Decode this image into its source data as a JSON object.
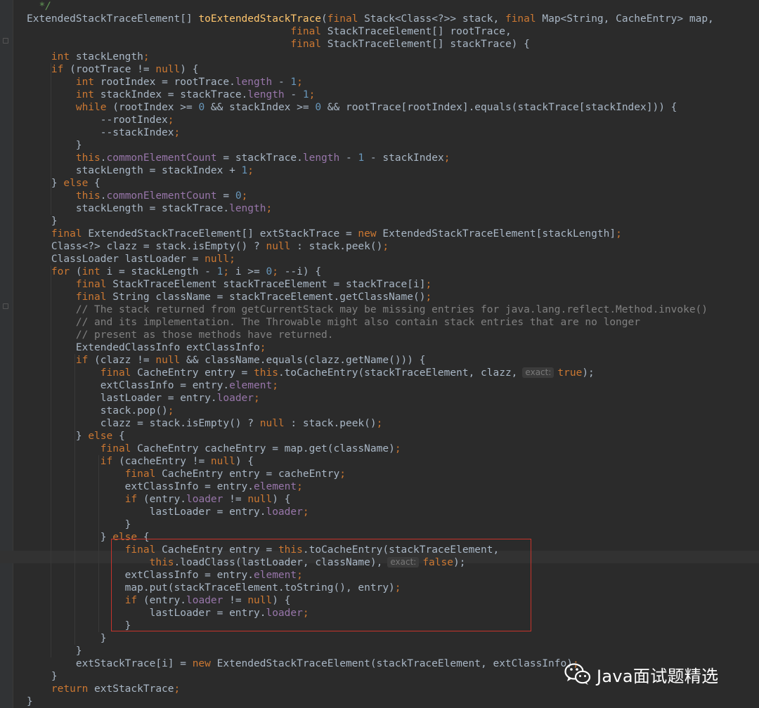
{
  "watermark": {
    "text": "Java面试题精选",
    "icon": "wechat-icon"
  },
  "hints": {
    "exact": "exact:"
  },
  "colors": {
    "background": "#2b2b2b",
    "keyword": "#cc7832",
    "number": "#6897bb",
    "method": "#ffc66d",
    "field": "#9876aa",
    "comment": "#808080",
    "highlight_box": "#c8342c"
  },
  "lines": [
    [
      {
        "t": "  */",
        "c": "doc"
      }
    ],
    [
      {
        "t": "ExtendedStackTraceElement[] "
      },
      {
        "t": "toExtendedStackTrace",
        "c": "fn"
      },
      {
        "t": "("
      },
      {
        "t": "final ",
        "c": "kw"
      },
      {
        "t": "Stack<Class<?>> stack, "
      },
      {
        "t": "final ",
        "c": "kw"
      },
      {
        "t": "Map<String, CacheEntry> map,"
      }
    ],
    [
      {
        "t": "                                           "
      },
      {
        "t": "final ",
        "c": "kw"
      },
      {
        "t": "StackTraceElement[] rootTrace,"
      }
    ],
    [
      {
        "t": "                                           "
      },
      {
        "t": "final ",
        "c": "kw"
      },
      {
        "t": "StackTraceElement[] stackTrace) {"
      }
    ],
    [
      {
        "t": "    "
      },
      {
        "t": "int ",
        "c": "kw"
      },
      {
        "t": "stackLength"
      },
      {
        "t": ";",
        "c": "kw"
      }
    ],
    [
      {
        "t": "    "
      },
      {
        "t": "if ",
        "c": "kw"
      },
      {
        "t": "(rootTrace != "
      },
      {
        "t": "null",
        "c": "kw"
      },
      {
        "t": ") {"
      }
    ],
    [
      {
        "t": "        "
      },
      {
        "t": "int ",
        "c": "kw"
      },
      {
        "t": "rootIndex = rootTrace."
      },
      {
        "t": "length",
        "c": "field"
      },
      {
        "t": " - "
      },
      {
        "t": "1",
        "c": "num"
      },
      {
        "t": ";",
        "c": "kw"
      }
    ],
    [
      {
        "t": "        "
      },
      {
        "t": "int ",
        "c": "kw"
      },
      {
        "t": "stackIndex = stackTrace."
      },
      {
        "t": "length",
        "c": "field"
      },
      {
        "t": " - "
      },
      {
        "t": "1",
        "c": "num"
      },
      {
        "t": ";",
        "c": "kw"
      }
    ],
    [
      {
        "t": "        "
      },
      {
        "t": "while ",
        "c": "kw"
      },
      {
        "t": "(rootIndex >= "
      },
      {
        "t": "0",
        "c": "num"
      },
      {
        "t": " && stackIndex >= "
      },
      {
        "t": "0",
        "c": "num"
      },
      {
        "t": " && rootTrace[rootIndex].equals(stackTrace[stackIndex])) {"
      }
    ],
    [
      {
        "t": "            --rootIndex"
      },
      {
        "t": ";",
        "c": "kw"
      }
    ],
    [
      {
        "t": "            --stackIndex"
      },
      {
        "t": ";",
        "c": "kw"
      }
    ],
    [
      {
        "t": "        }"
      }
    ],
    [
      {
        "t": "        "
      },
      {
        "t": "this",
        "c": "kw"
      },
      {
        "t": "."
      },
      {
        "t": "commonElementCount",
        "c": "field"
      },
      {
        "t": " = stackTrace."
      },
      {
        "t": "length",
        "c": "field"
      },
      {
        "t": " - "
      },
      {
        "t": "1",
        "c": "num"
      },
      {
        "t": " - stackIndex"
      },
      {
        "t": ";",
        "c": "kw"
      }
    ],
    [
      {
        "t": "        stackLength = stackIndex + "
      },
      {
        "t": "1",
        "c": "num"
      },
      {
        "t": ";",
        "c": "kw"
      }
    ],
    [
      {
        "t": "    } "
      },
      {
        "t": "else ",
        "c": "kw"
      },
      {
        "t": "{"
      }
    ],
    [
      {
        "t": "        "
      },
      {
        "t": "this",
        "c": "kw"
      },
      {
        "t": "."
      },
      {
        "t": "commonElementCount",
        "c": "field"
      },
      {
        "t": " = "
      },
      {
        "t": "0",
        "c": "num"
      },
      {
        "t": ";",
        "c": "kw"
      }
    ],
    [
      {
        "t": "        stackLength = stackTrace."
      },
      {
        "t": "length",
        "c": "field"
      },
      {
        "t": ";",
        "c": "kw"
      }
    ],
    [
      {
        "t": "    }"
      }
    ],
    [
      {
        "t": "    "
      },
      {
        "t": "final ",
        "c": "kw"
      },
      {
        "t": "ExtendedStackTraceElement[] extStackTrace = "
      },
      {
        "t": "new ",
        "c": "kw"
      },
      {
        "t": "ExtendedStackTraceElement[stackLength]"
      },
      {
        "t": ";",
        "c": "kw"
      }
    ],
    [
      {
        "t": "    Class<?> clazz = stack.isEmpty() ? "
      },
      {
        "t": "null ",
        "c": "kw"
      },
      {
        "t": ": stack.peek()"
      },
      {
        "t": ";",
        "c": "kw"
      }
    ],
    [
      {
        "t": "    ClassLoader lastLoader = "
      },
      {
        "t": "null",
        "c": "kw"
      },
      {
        "t": ";",
        "c": "kw"
      }
    ],
    [
      {
        "t": "    "
      },
      {
        "t": "for ",
        "c": "kw"
      },
      {
        "t": "("
      },
      {
        "t": "int ",
        "c": "kw"
      },
      {
        "t": "i = stackLength - "
      },
      {
        "t": "1",
        "c": "num"
      },
      {
        "t": "; ",
        "c": "kw"
      },
      {
        "t": "i >= "
      },
      {
        "t": "0",
        "c": "num"
      },
      {
        "t": "; ",
        "c": "kw"
      },
      {
        "t": "--i) {"
      }
    ],
    [
      {
        "t": "        "
      },
      {
        "t": "final ",
        "c": "kw"
      },
      {
        "t": "StackTraceElement stackTraceElement = stackTrace[i]"
      },
      {
        "t": ";",
        "c": "kw"
      }
    ],
    [
      {
        "t": "        "
      },
      {
        "t": "final ",
        "c": "kw"
      },
      {
        "t": "String className = stackTraceElement.getClassName()"
      },
      {
        "t": ";",
        "c": "kw"
      }
    ],
    [
      {
        "t": "        "
      },
      {
        "t": "// The stack returned from getCurrentStack may be missing entries for java.lang.reflect.Method.invoke()",
        "c": "cm"
      }
    ],
    [
      {
        "t": "        "
      },
      {
        "t": "// and its implementation. The Throwable might also contain stack entries that are no longer",
        "c": "cm"
      }
    ],
    [
      {
        "t": "        "
      },
      {
        "t": "// present as those methods have returned.",
        "c": "cm"
      }
    ],
    [
      {
        "t": "        ExtendedClassInfo extClassInfo"
      },
      {
        "t": ";",
        "c": "kw"
      }
    ],
    [
      {
        "t": "        "
      },
      {
        "t": "if ",
        "c": "kw"
      },
      {
        "t": "(clazz != "
      },
      {
        "t": "null ",
        "c": "kw"
      },
      {
        "t": "&& className.equals(clazz.getName())) {"
      }
    ],
    [
      {
        "t": "            "
      },
      {
        "t": "final ",
        "c": "kw"
      },
      {
        "t": "CacheEntry entry = "
      },
      {
        "t": "this",
        "c": "kw"
      },
      {
        "t": ".toCacheEntry(stackTraceElement, clazz,"
      },
      {
        "h": "exact"
      },
      {
        "t": "true",
        "c": "kw"
      },
      {
        "t": ");"
      }
    ],
    [
      {
        "t": "            extClassInfo = entry."
      },
      {
        "t": "element",
        "c": "field"
      },
      {
        "t": ";",
        "c": "kw"
      }
    ],
    [
      {
        "t": "            lastLoader = entry."
      },
      {
        "t": "loader",
        "c": "field"
      },
      {
        "t": ";",
        "c": "kw"
      }
    ],
    [
      {
        "t": "            stack.pop()"
      },
      {
        "t": ";",
        "c": "kw"
      }
    ],
    [
      {
        "t": "            clazz = stack.isEmpty() ? "
      },
      {
        "t": "null ",
        "c": "kw"
      },
      {
        "t": ": stack.peek()"
      },
      {
        "t": ";",
        "c": "kw"
      }
    ],
    [
      {
        "t": "        } "
      },
      {
        "t": "else ",
        "c": "kw"
      },
      {
        "t": "{"
      }
    ],
    [
      {
        "t": "            "
      },
      {
        "t": "final ",
        "c": "kw"
      },
      {
        "t": "CacheEntry cacheEntry = map.get(className)"
      },
      {
        "t": ";",
        "c": "kw"
      }
    ],
    [
      {
        "t": "            "
      },
      {
        "t": "if ",
        "c": "kw"
      },
      {
        "t": "(cacheEntry != "
      },
      {
        "t": "null",
        "c": "kw"
      },
      {
        "t": ") {"
      }
    ],
    [
      {
        "t": "                "
      },
      {
        "t": "final ",
        "c": "kw"
      },
      {
        "t": "CacheEntry entry = cacheEntry"
      },
      {
        "t": ";",
        "c": "kw"
      }
    ],
    [
      {
        "t": "                extClassInfo = entry."
      },
      {
        "t": "element",
        "c": "field"
      },
      {
        "t": ";",
        "c": "kw"
      }
    ],
    [
      {
        "t": "                "
      },
      {
        "t": "if ",
        "c": "kw"
      },
      {
        "t": "(entry."
      },
      {
        "t": "loader",
        "c": "field"
      },
      {
        "t": " != "
      },
      {
        "t": "null",
        "c": "kw"
      },
      {
        "t": ") {"
      }
    ],
    [
      {
        "t": "                    lastLoader = entry."
      },
      {
        "t": "loader",
        "c": "field"
      },
      {
        "t": ";",
        "c": "kw"
      }
    ],
    [
      {
        "t": "                }"
      }
    ],
    [
      {
        "t": "            } "
      },
      {
        "t": "else ",
        "c": "kw"
      },
      {
        "t": "{"
      }
    ],
    [
      {
        "t": "                "
      },
      {
        "t": "final ",
        "c": "kw"
      },
      {
        "t": "CacheEntry entry = "
      },
      {
        "t": "this",
        "c": "kw"
      },
      {
        "t": ".toCacheEntry(stackTraceElement,"
      }
    ],
    [
      {
        "t": "                    "
      },
      {
        "t": "this",
        "c": "kw"
      },
      {
        "t": ".loadClass(lastLoader, className),"
      },
      {
        "h": "exact"
      },
      {
        "t": "false",
        "c": "kw"
      },
      {
        "t": ");"
      }
    ],
    [
      {
        "t": "                extClassInfo = entry."
      },
      {
        "t": "element",
        "c": "field"
      },
      {
        "t": ";",
        "c": "kw"
      }
    ],
    [
      {
        "t": "                map.put(stackTraceElement.toString(), entry)"
      },
      {
        "t": ";",
        "c": "kw"
      }
    ],
    [
      {
        "t": "                "
      },
      {
        "t": "if ",
        "c": "kw"
      },
      {
        "t": "(entry."
      },
      {
        "t": "loader",
        "c": "field"
      },
      {
        "t": " != "
      },
      {
        "t": "null",
        "c": "kw"
      },
      {
        "t": ") {"
      }
    ],
    [
      {
        "t": "                    lastLoader = entry."
      },
      {
        "t": "loader",
        "c": "field"
      },
      {
        "t": ";",
        "c": "kw"
      }
    ],
    [
      {
        "t": "                }"
      }
    ],
    [
      {
        "t": "            }"
      }
    ],
    [
      {
        "t": "        }"
      }
    ],
    [
      {
        "t": "        extStackTrace[i] = "
      },
      {
        "t": "new ",
        "c": "kw"
      },
      {
        "t": "ExtendedStackTraceElement(stackTraceElement, extClassInfo)"
      },
      {
        "t": ";",
        "c": "kw"
      }
    ],
    [
      {
        "t": "    }"
      }
    ],
    [
      {
        "t": "    "
      },
      {
        "t": "return ",
        "c": "kw"
      },
      {
        "t": "extStackTrace"
      },
      {
        "t": ";",
        "c": "kw"
      }
    ],
    [
      {
        "t": "}"
      }
    ]
  ]
}
